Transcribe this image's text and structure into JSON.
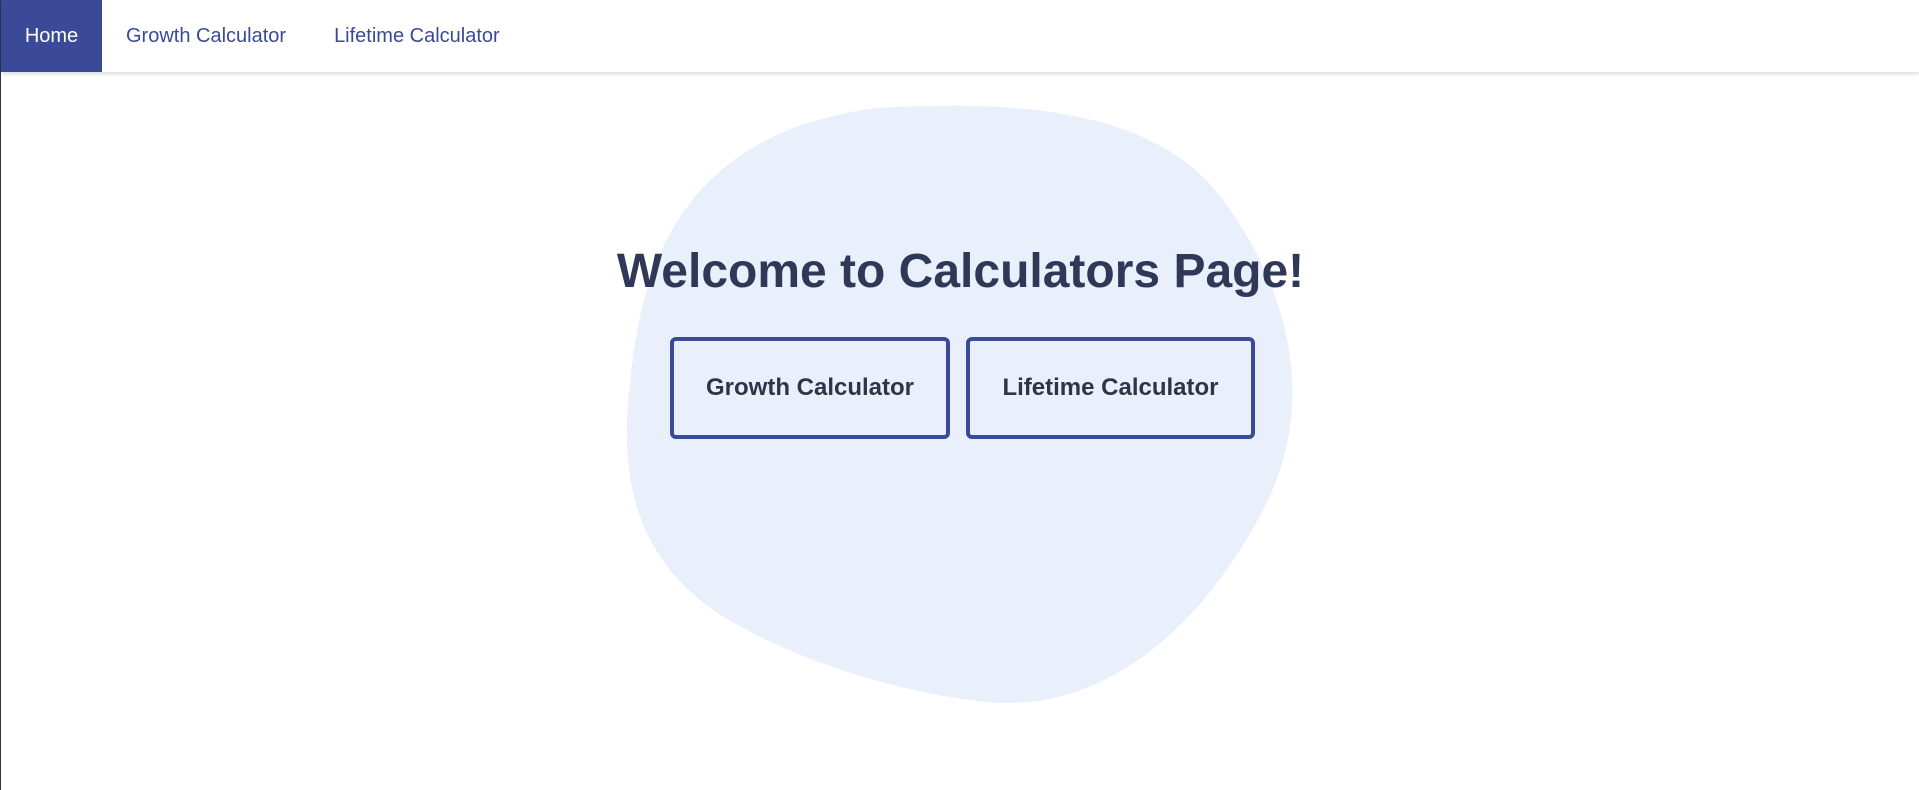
{
  "nav": {
    "items": [
      {
        "label": "Home",
        "active": true
      },
      {
        "label": "Growth Calculator",
        "active": false
      },
      {
        "label": "Lifetime Calculator",
        "active": false
      }
    ]
  },
  "hero": {
    "title": "Welcome to Calculators Page!",
    "buttons": [
      {
        "label": "Growth Calculator"
      },
      {
        "label": "Lifetime Calculator"
      }
    ]
  },
  "colors": {
    "accent": "#3a4a98",
    "blob": "#eaf0fb",
    "heading": "#2f3857"
  }
}
